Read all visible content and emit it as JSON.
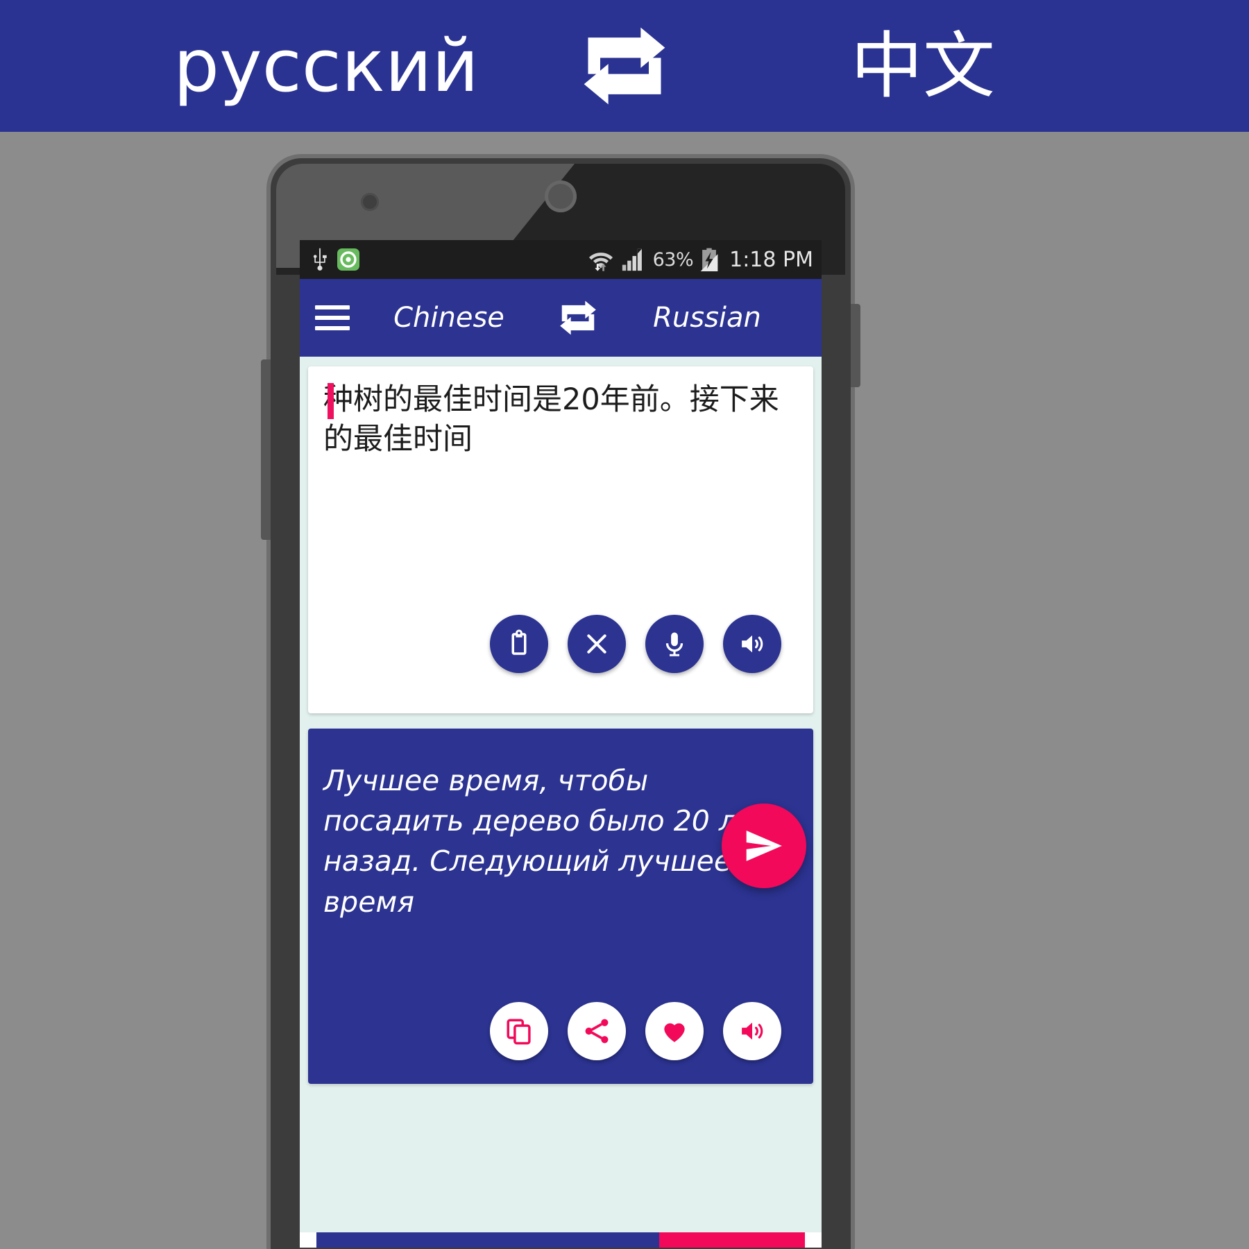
{
  "banner": {
    "left_language": "русский",
    "right_language": "中文",
    "swap_icon": "swap-repeat-icon",
    "background_color": "#2b3392",
    "text_color": "#ffffff"
  },
  "phone": {
    "status_bar": {
      "usb_icon": "usb-icon",
      "app_icon": "green-app-icon",
      "wifi_icon": "wifi-data-icon",
      "signal_icon": "cellular-signal-icon",
      "battery_percent": "63%",
      "battery_icon": "battery-charging-icon",
      "time": "1:18 PM"
    },
    "toolbar": {
      "menu_icon": "hamburger-menu-icon",
      "source_language": "Chinese",
      "swap_icon": "swap-languages-icon",
      "target_language": "Russian",
      "background_color": "#2c3391"
    },
    "input_card": {
      "text": "种树的最佳时间是20年前。接下来的最佳时间",
      "caret_color": "#ef1060",
      "actions": [
        {
          "name": "paste-button",
          "icon": "clipboard-icon"
        },
        {
          "name": "clear-button",
          "icon": "close-x-icon"
        },
        {
          "name": "voice-input-button",
          "icon": "microphone-icon"
        },
        {
          "name": "speak-source-button",
          "icon": "speaker-icon"
        }
      ]
    },
    "send_button": {
      "name": "translate-send-button",
      "icon": "send-paper-plane-icon",
      "color": "#f2095a"
    },
    "output_card": {
      "text": "Лучшее время, чтобы посадить дерево было 20 лет назад. Следующий лучшее время",
      "background_color": "#2c3391",
      "actions": [
        {
          "name": "copy-button",
          "icon": "copy-icon"
        },
        {
          "name": "share-button",
          "icon": "share-icon"
        },
        {
          "name": "favorite-button",
          "icon": "heart-icon"
        },
        {
          "name": "speak-target-button",
          "icon": "speaker-icon"
        }
      ]
    }
  },
  "colors": {
    "brand_blue": "#2c3391",
    "accent_pink": "#f2095a",
    "screen_bg": "#e2f0ee",
    "page_bg": "#8c8c8c"
  }
}
